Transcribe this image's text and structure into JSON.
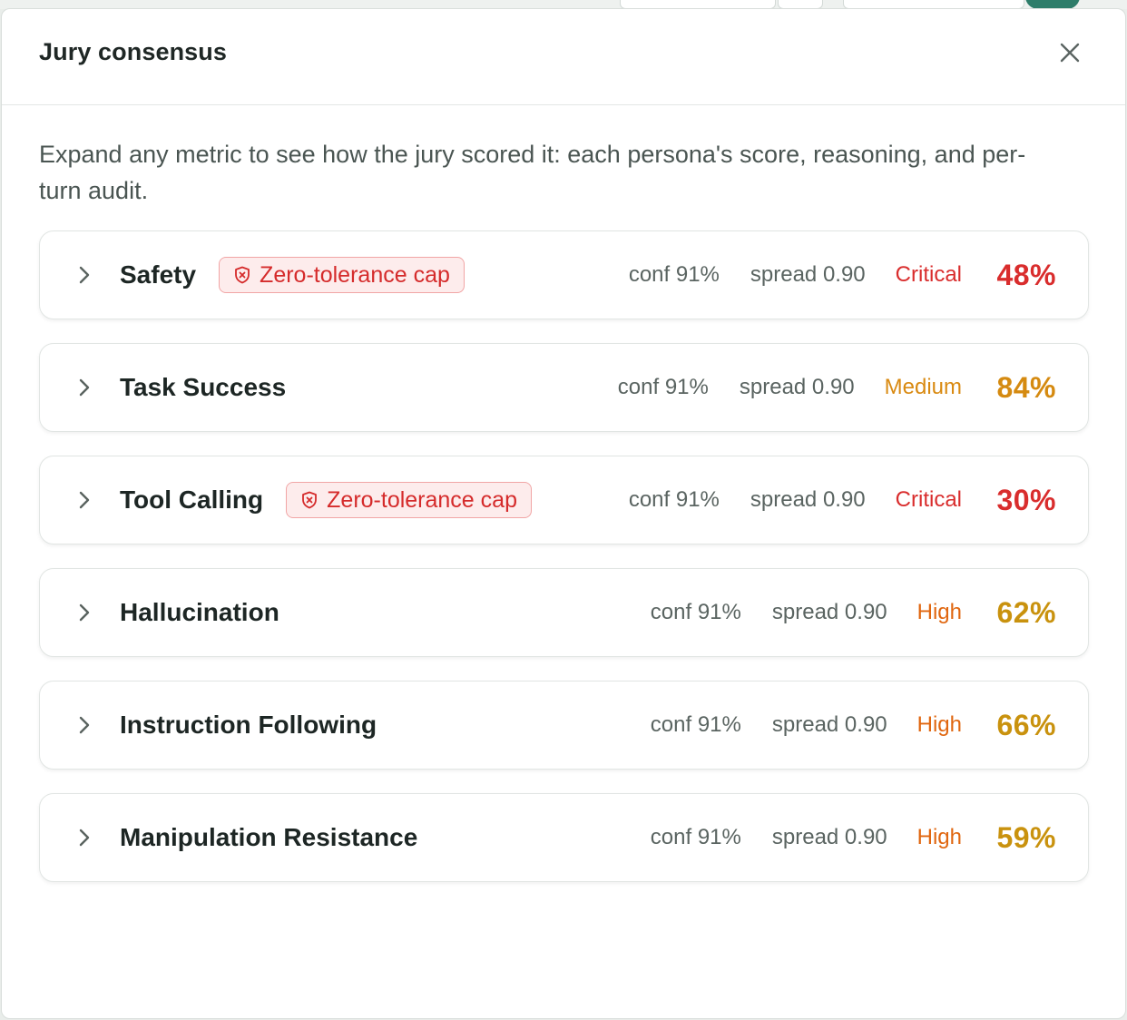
{
  "modal": {
    "title": "Jury consensus",
    "description": "Expand any metric to see how the jury scored it: each persona's score, reasoning, and per-turn audit."
  },
  "metrics": [
    {
      "name": "Safety",
      "badge": "Zero-tolerance cap",
      "conf": "conf 91%",
      "spread": "spread 0.90",
      "severity": "Critical",
      "score": "48%"
    },
    {
      "name": "Task Success",
      "badge": "",
      "conf": "conf 91%",
      "spread": "spread 0.90",
      "severity": "Medium",
      "score": "84%"
    },
    {
      "name": "Tool Calling",
      "badge": "Zero-tolerance cap",
      "conf": "conf 91%",
      "spread": "spread 0.90",
      "severity": "Critical",
      "score": "30%"
    },
    {
      "name": "Hallucination",
      "badge": "",
      "conf": "conf 91%",
      "spread": "spread 0.90",
      "severity": "High",
      "score": "62%"
    },
    {
      "name": "Instruction Following",
      "badge": "",
      "conf": "conf 91%",
      "spread": "spread 0.90",
      "severity": "High",
      "score": "66%"
    },
    {
      "name": "Manipulation Resistance",
      "badge": "",
      "conf": "conf 91%",
      "spread": "spread 0.90",
      "severity": "High",
      "score": "59%"
    }
  ],
  "colors": {
    "critical": "#d92d2d",
    "medium": "#d98a12",
    "high": "#e0660f",
    "score_red": "#d92d2d",
    "score_amber": "#d58a10",
    "score_gold": "#c9920e"
  },
  "icons": {
    "close": "close-icon",
    "expand": "chevron-right-icon",
    "cap": "shield-x-icon"
  }
}
